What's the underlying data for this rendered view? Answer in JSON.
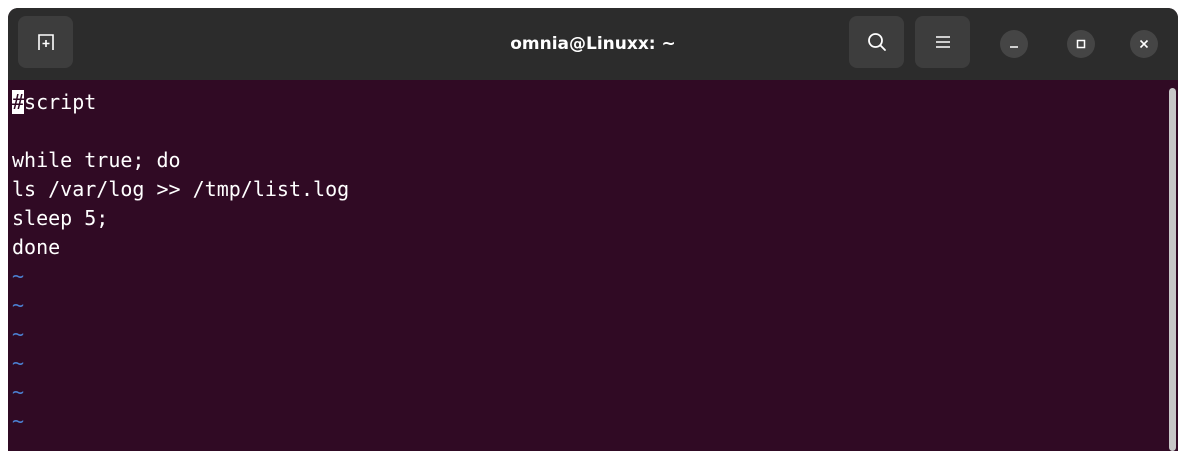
{
  "window": {
    "title": "omnia@Linuxx: ~"
  },
  "titlebar": {
    "new_tab_icon": "new-tab-icon",
    "search_icon": "search-icon",
    "menu_icon": "hamburger-menu-icon",
    "minimize_icon": "minimize-icon",
    "maximize_icon": "maximize-icon",
    "close_icon": "close-icon"
  },
  "editor": {
    "cursor_char": "#",
    "first_line_rest": "script",
    "lines": [
      "",
      "while true; do",
      "ls /var/log >> /tmp/list.log",
      "sleep 5;",
      "done"
    ],
    "tilde": "~"
  },
  "colors": {
    "terminal_bg": "#300a24",
    "titlebar_bg": "#2c2c2c",
    "tilde": "#4b7fd0",
    "text": "#ffffff"
  }
}
